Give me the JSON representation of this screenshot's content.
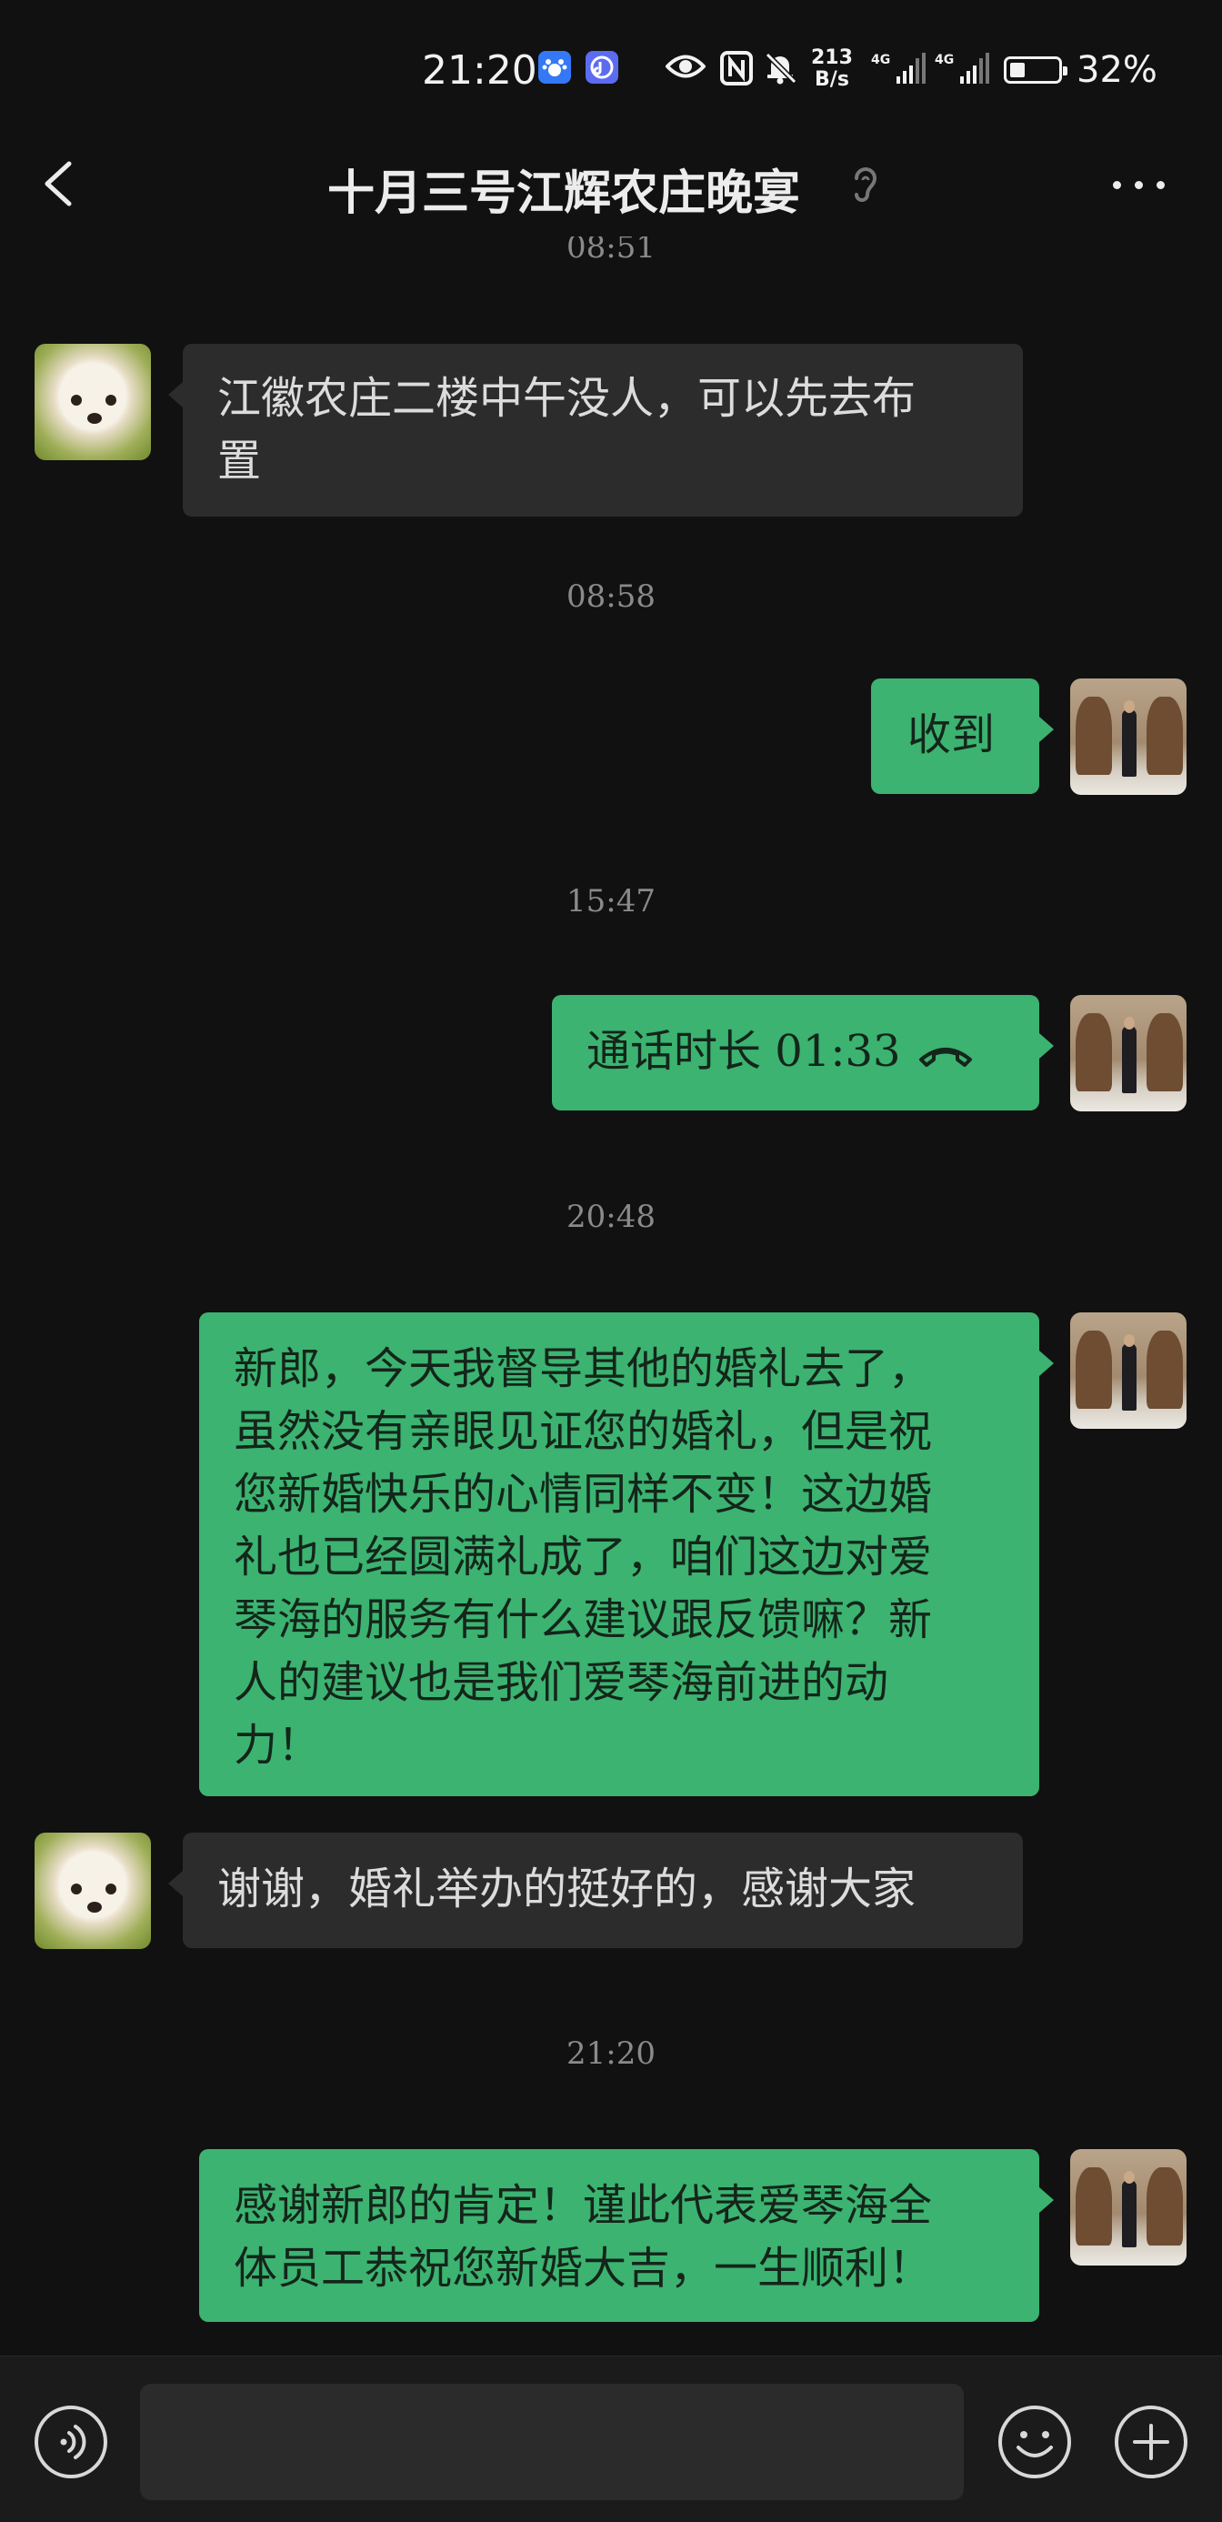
{
  "status_bar": {
    "time": "21:20",
    "speed_value": "213",
    "speed_unit": "B/s",
    "network_1": "4G",
    "network_2": "4G",
    "battery_percent": "32%",
    "icons": [
      "baidu-app-icon",
      "music-app-icon",
      "eye-icon",
      "nfc-icon",
      "bell-off-icon",
      "signal-icon",
      "battery-icon"
    ]
  },
  "header": {
    "title": "十月三号江辉农庄晚宴",
    "back_icon": "back-arrow-icon",
    "ear_icon": "earpiece-mode-icon",
    "more_icon": "more-icon"
  },
  "messages": [
    {
      "type": "timestamp",
      "text": "08:51"
    },
    {
      "type": "incoming",
      "text_lines": [
        "江徽农庄二楼中午没人，可以先去布",
        "置"
      ]
    },
    {
      "type": "timestamp",
      "text": "08:58"
    },
    {
      "type": "outgoing",
      "text_lines": [
        "收到"
      ]
    },
    {
      "type": "timestamp",
      "text": "15:47"
    },
    {
      "type": "outgoing_call",
      "text": "通话时长 01:33"
    },
    {
      "type": "timestamp",
      "text": "20:48"
    },
    {
      "type": "outgoing",
      "text_lines": [
        "新郎，今天我督导其他的婚礼去了，",
        "虽然没有亲眼见证您的婚礼，但是祝",
        "您新婚快乐的心情同样不变！这边婚",
        "礼也已经圆满礼成了，咱们这边对爱",
        "琴海的服务有什么建议跟反馈嘛？新",
        "人的建议也是我们爱琴海前进的动",
        "力！"
      ]
    },
    {
      "type": "incoming",
      "text_lines": [
        "谢谢，婚礼举办的挺好的，感谢大家"
      ]
    },
    {
      "type": "timestamp",
      "text": "21:20"
    },
    {
      "type": "outgoing",
      "text_lines": [
        "感谢新郎的肯定！谨此代表爱琴海全",
        "体员工恭祝您新婚大吉，一生顺利！"
      ]
    }
  ],
  "input_bar": {
    "voice_icon": "voice-icon",
    "emoji_icon": "emoji-icon",
    "plus_icon": "plus-icon",
    "input_value": ""
  },
  "colors": {
    "background": "#111111",
    "incoming_bubble": "#2c2c2c",
    "outgoing_bubble": "#3cb371",
    "timestamp": "#8a8a8a"
  }
}
